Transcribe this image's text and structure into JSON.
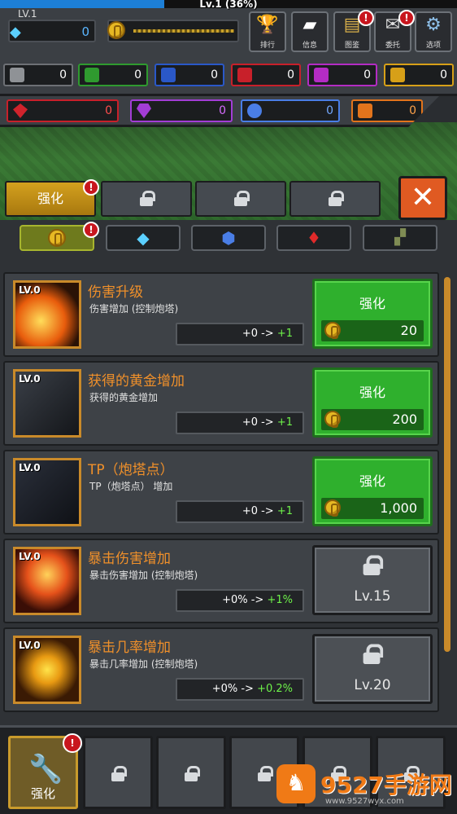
{
  "header": {
    "xp_text": "Lv.1 (36%)",
    "xp_percent": 36,
    "level": "LV.1",
    "gems": "0"
  },
  "top_buttons": [
    {
      "label": "排行",
      "icon": "trophy-icon",
      "alert": false
    },
    {
      "label": "信息",
      "icon": "book-icon",
      "alert": false
    },
    {
      "label": "图鉴",
      "icon": "codex-icon",
      "alert": true
    },
    {
      "label": "委托",
      "icon": "commission-icon",
      "alert": true
    },
    {
      "label": "选项",
      "icon": "gear-icon",
      "alert": false
    }
  ],
  "ores_row1": [
    {
      "value": "0",
      "color": "#8f9296"
    },
    {
      "value": "0",
      "color": "#2f9a2f"
    },
    {
      "value": "0",
      "color": "#2a58c8"
    },
    {
      "value": "0",
      "color": "#c8202a"
    },
    {
      "value": "0",
      "color": "#b42cc4"
    },
    {
      "value": "0",
      "color": "#d7a018"
    }
  ],
  "ores_row2": [
    {
      "value": "0",
      "color": "#d0232c",
      "icon": "red-crystal-icon"
    },
    {
      "value": "0",
      "color": "#a33dd6",
      "icon": "purple-gem-icon"
    },
    {
      "value": "0",
      "color": "#4a7ee6",
      "icon": "blue-orb-icon"
    },
    {
      "value": "0",
      "color": "#e2741c",
      "icon": "orange-ore-icon"
    }
  ],
  "tabs": {
    "active_label": "强化",
    "close": "✕"
  },
  "upgrades": [
    {
      "level": "LV.0",
      "title": "伤害升级",
      "desc": "伤害增加 (控制炮塔)",
      "from": "+0 -> ",
      "to": "+1",
      "button": "强化",
      "price": "20",
      "locked": false,
      "req": ""
    },
    {
      "level": "LV.0",
      "title": "获得的黄金增加",
      "desc": "获得的黄金增加",
      "from": "+0 -> ",
      "to": "+1",
      "button": "强化",
      "price": "200",
      "locked": false,
      "req": ""
    },
    {
      "level": "LV.0",
      "title": "TP（炮塔点）",
      "desc": "TP（炮塔点） 增加",
      "from": "+0 -> ",
      "to": "+1",
      "button": "强化",
      "price": "1,000",
      "locked": false,
      "req": ""
    },
    {
      "level": "LV.0",
      "title": "暴击伤害增加",
      "desc": "暴击伤害增加 (控制炮塔)",
      "from": "+0% -> ",
      "to": "+1%",
      "button": "",
      "price": "",
      "locked": true,
      "req": "Lv.15"
    },
    {
      "level": "LV.0",
      "title": "暴击几率增加",
      "desc": "暴击几率增加 (控制炮塔)",
      "from": "+0% -> ",
      "to": "+0.2%",
      "button": "",
      "price": "",
      "locked": true,
      "req": "Lv.20"
    }
  ],
  "bottom": {
    "active_label": "强化"
  },
  "watermark": {
    "text": "9527手游网",
    "url": "www.9527wyx.com",
    "logo": "♞"
  }
}
